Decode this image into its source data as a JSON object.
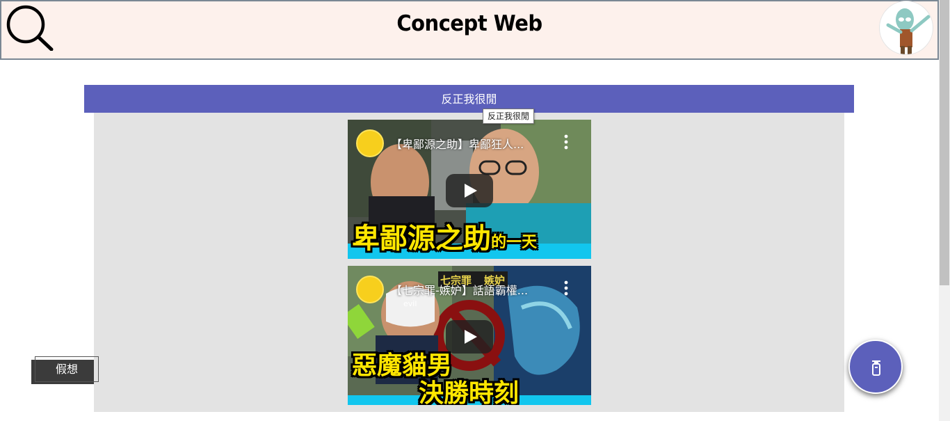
{
  "header": {
    "title": "Concept Web",
    "search_icon": "search-icon",
    "avatar": "avatar"
  },
  "section": {
    "title": "反正我很閒",
    "tooltip": "反正我很閒"
  },
  "videos": [
    {
      "title": "【卑鄙源之助】卑鄙狂人...",
      "caption_main": "卑鄙源之助",
      "caption_small": "的一天",
      "icons": [
        "channel-avatar-icon",
        "more-vert-icon",
        "play-icon"
      ]
    },
    {
      "title": "【七宗罪-嫉妒】話語霸權...",
      "caption_line1": "惡魔貓男",
      "caption_line2": "決勝時刻",
      "sign_left": "七宗罪",
      "sign_right": "嫉妒",
      "mask_text": "evil",
      "icons": [
        "channel-avatar-icon",
        "more-vert-icon",
        "play-icon"
      ]
    }
  ],
  "hypothesis_button": {
    "label": "假想"
  },
  "fab": {
    "icon": "fire-extinguisher-icon"
  },
  "colors": {
    "accent": "#5c60bb",
    "header_bg": "#fdf1ec",
    "content_bg": "#e3e3e3"
  }
}
